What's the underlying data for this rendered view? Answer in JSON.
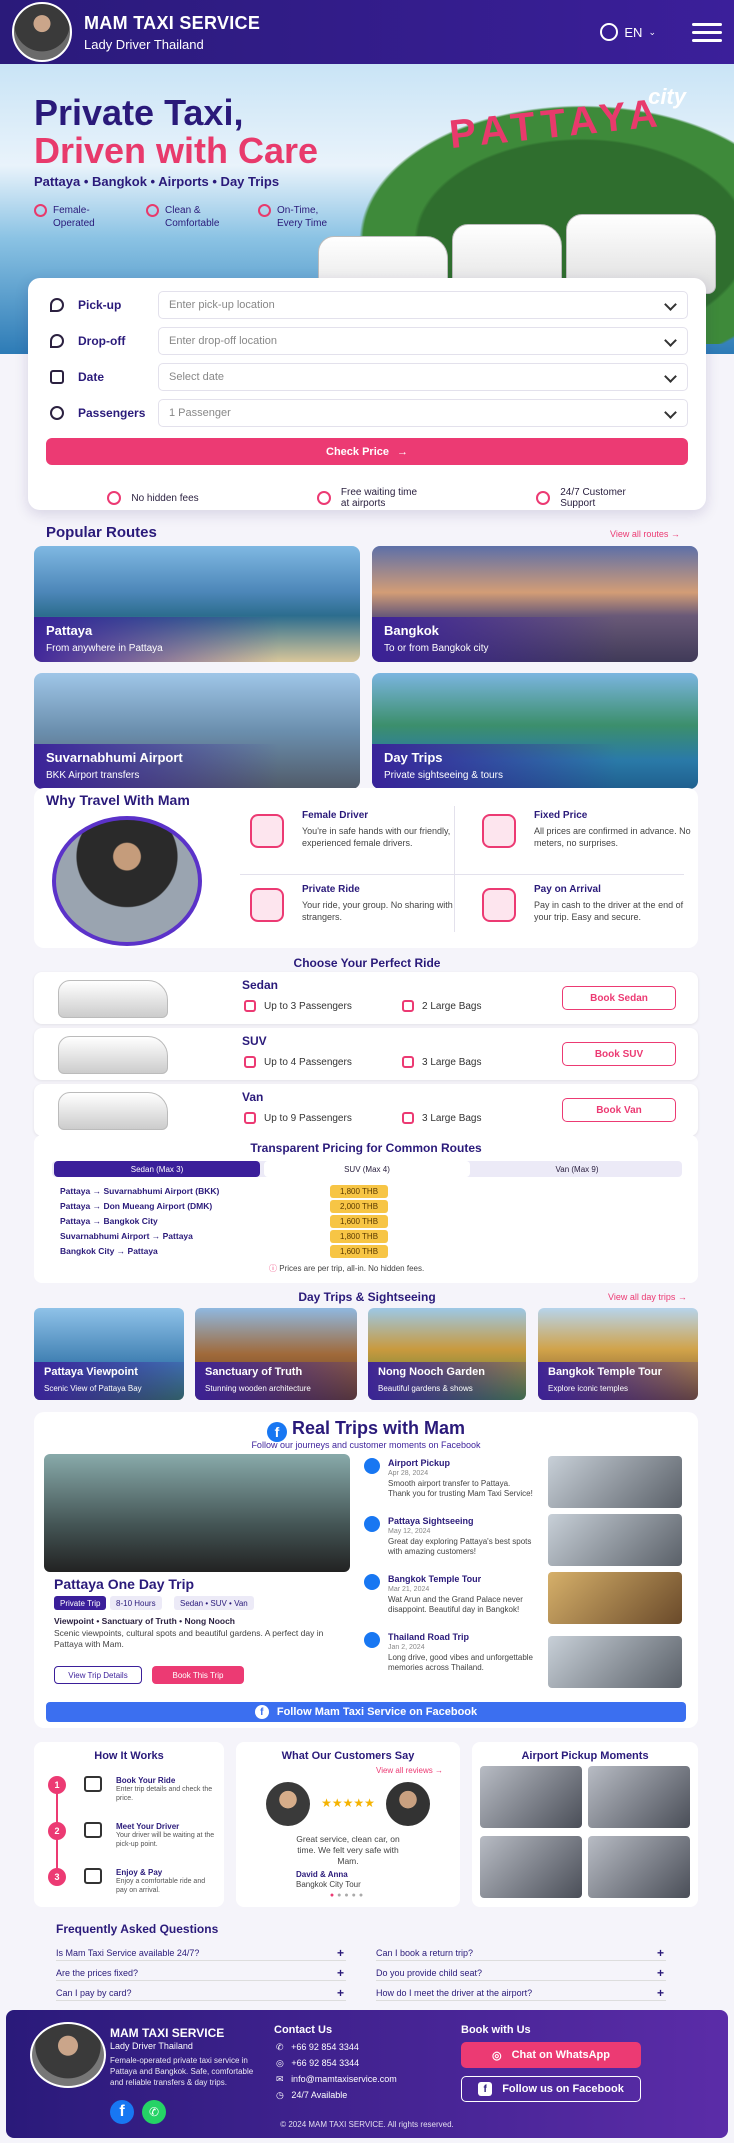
{
  "header": {
    "brand": "MAM TAXI SERVICE",
    "tagline": "Lady Driver Thailand",
    "lang": "EN"
  },
  "hero": {
    "line1": "Private Taxi,",
    "line2": "Driven with Care",
    "places": "Pattaya • Bangkok • Airports • Day Trips",
    "sign": "PATTAYA",
    "sign_city": "city",
    "features": [
      {
        "icon": "female-icon",
        "label": "Female-\nOperated"
      },
      {
        "icon": "shield-icon",
        "label": "Clean &\nComfortable"
      },
      {
        "icon": "clock-icon",
        "label": "On-Time,\nEvery Time"
      }
    ]
  },
  "booking": {
    "fields": [
      {
        "icon": "pin-icon",
        "label": "Pick-up",
        "placeholder": "Enter pick-up location"
      },
      {
        "icon": "pin-icon",
        "label": "Drop-off",
        "placeholder": "Enter drop-off location"
      },
      {
        "icon": "calendar-icon",
        "label": "Date",
        "placeholder": "Select date"
      },
      {
        "icon": "person-icon",
        "label": "Passengers",
        "placeholder": "1 Passenger"
      }
    ],
    "button": "Check Price",
    "trust": [
      "No hidden fees",
      "Free waiting time\nat airports",
      "24/7 Customer\nSupport"
    ]
  },
  "routes": {
    "title": "Popular Routes",
    "more": "View all routes →",
    "items": [
      {
        "name": "Pattaya",
        "desc": "From anywhere in Pattaya"
      },
      {
        "name": "Bangkok",
        "desc": "To or from Bangkok city"
      },
      {
        "name": "Suvarnabhumi Airport",
        "desc": "BKK Airport transfers"
      },
      {
        "name": "Day Trips",
        "desc": "Private sightseeing & tours"
      }
    ]
  },
  "why": {
    "title": "Why Travel With Mam",
    "items": [
      {
        "title": "Female Driver",
        "text": "You're in safe hands with our friendly, experienced female drivers."
      },
      {
        "title": "Fixed Price",
        "text": "All prices are confirmed in advance. No meters, no surprises."
      },
      {
        "title": "Private Ride",
        "text": "Your ride, your group. No sharing with strangers."
      },
      {
        "title": "Pay on Arrival",
        "text": "Pay in cash to the driver at the end of your trip. Easy and secure."
      }
    ]
  },
  "rides": {
    "title": "Choose Your Perfect Ride",
    "items": [
      {
        "name": "Sedan",
        "pax": "Up to 3 Passengers",
        "bags": "2 Large Bags",
        "btn": "Book Sedan"
      },
      {
        "name": "SUV",
        "pax": "Up to 4 Passengers",
        "bags": "3 Large Bags",
        "btn": "Book SUV"
      },
      {
        "name": "Van",
        "pax": "Up to 9 Passengers",
        "bags": "3 Large Bags",
        "btn": "Book Van"
      }
    ]
  },
  "pricing": {
    "title": "Transparent Pricing for Common Routes",
    "tabs": [
      "Sedan (Max 3)",
      "SUV (Max 4)",
      "Van (Max 9)"
    ],
    "rows": [
      {
        "route": "Pattaya → Suvarnabhumi Airport (BKK)",
        "price": "1,800 THB"
      },
      {
        "route": "Pattaya → Don Mueang Airport (DMK)",
        "price": "2,000 THB"
      },
      {
        "route": "Pattaya → Bangkok City",
        "price": "1,600 THB"
      },
      {
        "route": "Suvarnabhumi Airport → Pattaya",
        "price": "1,800 THB"
      },
      {
        "route": "Bangkok City → Pattaya",
        "price": "1,600 THB"
      }
    ],
    "note": "Prices are per trip, all-in. No hidden fees."
  },
  "daytrips": {
    "title": "Day Trips & Sightseeing",
    "more": "View all day trips →",
    "items": [
      {
        "name": "Pattaya Viewpoint",
        "desc": "Scenic View of Pattaya Bay"
      },
      {
        "name": "Sanctuary of Truth",
        "desc": "Stunning wooden architecture"
      },
      {
        "name": "Nong Nooch Garden",
        "desc": "Beautiful gardens & shows"
      },
      {
        "name": "Bangkok Temple Tour",
        "desc": "Explore iconic temples"
      }
    ]
  },
  "facebook": {
    "title": "Real Trips with Mam",
    "subtitle": "Follow our journeys and customer moments on Facebook",
    "feature": {
      "title": "Pattaya One Day Trip",
      "tags": [
        "Private Trip",
        "8-10 Hours",
        "Sedan • SUV • Van"
      ],
      "stops": "Viewpoint  •  Sanctuary of Truth  •  Nong Nooch",
      "text": "Scenic viewpoints, cultural spots and beautiful gardens. A perfect day in Pattaya with Mam.",
      "btn1": "View Trip Details",
      "btn2": "Book This Trip"
    },
    "posts": [
      {
        "title": "Airport Pickup",
        "date": "Apr 28, 2024",
        "text": "Smooth airport transfer to Pattaya. Thank you for trusting Mam Taxi Service!"
      },
      {
        "title": "Pattaya Sightseeing",
        "date": "May 12, 2024",
        "text": "Great day exploring Pattaya's best spots with amazing customers!"
      },
      {
        "title": "Bangkok Temple Tour",
        "date": "Mar 21, 2024",
        "text": "Wat Arun and the Grand Palace never disappoint. Beautiful day in Bangkok!"
      },
      {
        "title": "Thailand Road Trip",
        "date": "Jan 2, 2024",
        "text": "Long drive, good vibes and unforgettable memories across Thailand."
      }
    ],
    "button": "Follow Mam Taxi Service on Facebook"
  },
  "how": {
    "title": "How It Works",
    "steps": [
      {
        "n": "1",
        "title": "Book Your Ride",
        "text": "Enter trip details and check the price."
      },
      {
        "n": "2",
        "title": "Meet Your Driver",
        "text": "Your driver will be waiting at the pick-up point."
      },
      {
        "n": "3",
        "title": "Enjoy & Pay",
        "text": "Enjoy a comfortable ride and pay on arrival."
      }
    ]
  },
  "reviews": {
    "title": "What Our Customers Say",
    "more": "View all reviews →",
    "stars": "★★★★★",
    "text": "Great service, clean car, on time. We felt very safe with Mam.",
    "author": "David & Anna",
    "trip": "Bangkok City Tour"
  },
  "moments": {
    "title": "Airport Pickup Moments"
  },
  "faq": {
    "title": "Frequently Asked Questions",
    "items": [
      "Is Mam Taxi Service available 24/7?",
      "Are the prices fixed?",
      "Can I pay by card?",
      "Can I book a return trip?",
      "Do you provide child seat?",
      "How do I meet the driver at the airport?"
    ]
  },
  "footer": {
    "brand": "MAM TAXI SERVICE",
    "tagline": "Lady Driver Thailand",
    "about": "Female-operated private taxi service in Pattaya and Bangkok. Safe, comfortable and reliable transfers & day trips.",
    "contact_title": "Contact Us",
    "phone1": "+66 92 854 3344",
    "phone2": "+66 92 854 3344",
    "email": "info@mamtaxiservice.com",
    "hours": "24/7 Available",
    "book_title": "Book with Us",
    "whatsapp": "Chat on WhatsApp",
    "fbfollow": "Follow us on Facebook",
    "copyright": "© 2024 MAM TAXI SERVICE. All rights reserved."
  },
  "colors": {
    "primary": "#2a1a7a",
    "accent": "#ec3a73",
    "facebook": "#1877f2",
    "whatsapp": "#25d366",
    "price": "#f7c545"
  }
}
